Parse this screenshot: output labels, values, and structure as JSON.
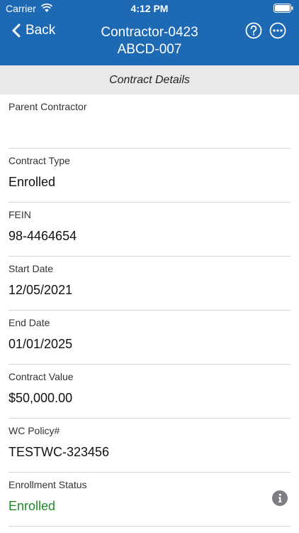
{
  "status_bar": {
    "carrier": "Carrier",
    "time": "4:12 PM"
  },
  "nav": {
    "back_label": "Back",
    "title_line1": "Contractor-0423",
    "title_line2": "ABCD-007",
    "help_icon": "question-circle-icon",
    "more_icon": "ellipsis-circle-icon"
  },
  "section": {
    "title": "Contract Details"
  },
  "fields": [
    {
      "label": "Parent Contractor",
      "value": ""
    },
    {
      "label": "Contract Type",
      "value": "Enrolled"
    },
    {
      "label": "FEIN",
      "value": "98-4464654"
    },
    {
      "label": "Start Date",
      "value": "12/05/2021"
    },
    {
      "label": "End Date",
      "value": "01/01/2025"
    },
    {
      "label": "Contract Value",
      "value": "$50,000.00"
    },
    {
      "label": "WC Policy#",
      "value": "TESTWC-323456"
    },
    {
      "label": "Enrollment Status",
      "value": "Enrolled",
      "info_icon": "info-circle-icon"
    }
  ],
  "colors": {
    "header_bg": "#1d69b4",
    "status_green": "#1f8a2a",
    "section_bg": "#e9e9e9"
  }
}
